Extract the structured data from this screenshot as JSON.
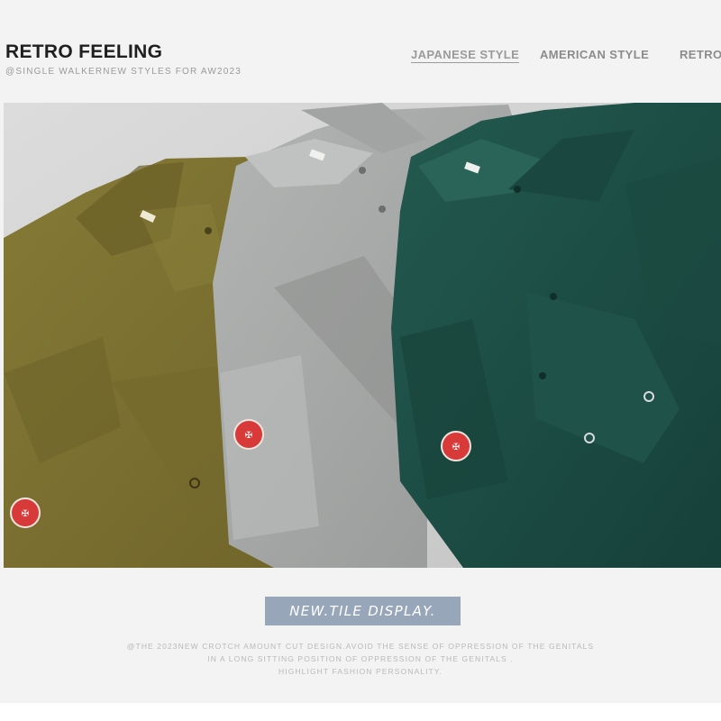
{
  "header": {
    "title": "RETRO FEELING",
    "subtitle": "@SINGLE WALKERNEW STYLES FOR AW2023"
  },
  "nav": {
    "items": [
      {
        "label": "JAPANESE STYLE",
        "active": true
      },
      {
        "label": "AMERICAN STYLE",
        "active": false
      },
      {
        "label": "RETRO",
        "active": false
      }
    ]
  },
  "hero": {
    "image_description": "three folded shirts in olive, grey and dark green with red round patches",
    "colors": {
      "olive": "#7c7030",
      "grey": "#a7a9a8",
      "green": "#1f4e45",
      "patch": "#d83a3a"
    }
  },
  "cta": {
    "label": "NEW.TILE DISPLAY."
  },
  "description": {
    "lines": [
      "@THE 2023NEW CROTCH AMOUNT CUT DESIGN.AVOID THE SENSE OF OPPRESSION OF THE GENITALS",
      "IN A LONG SITTING POSITION OF OPPRESSION OF THE GENITALS .",
      "HIGHLIGHT FASHION PERSONALITY."
    ]
  }
}
